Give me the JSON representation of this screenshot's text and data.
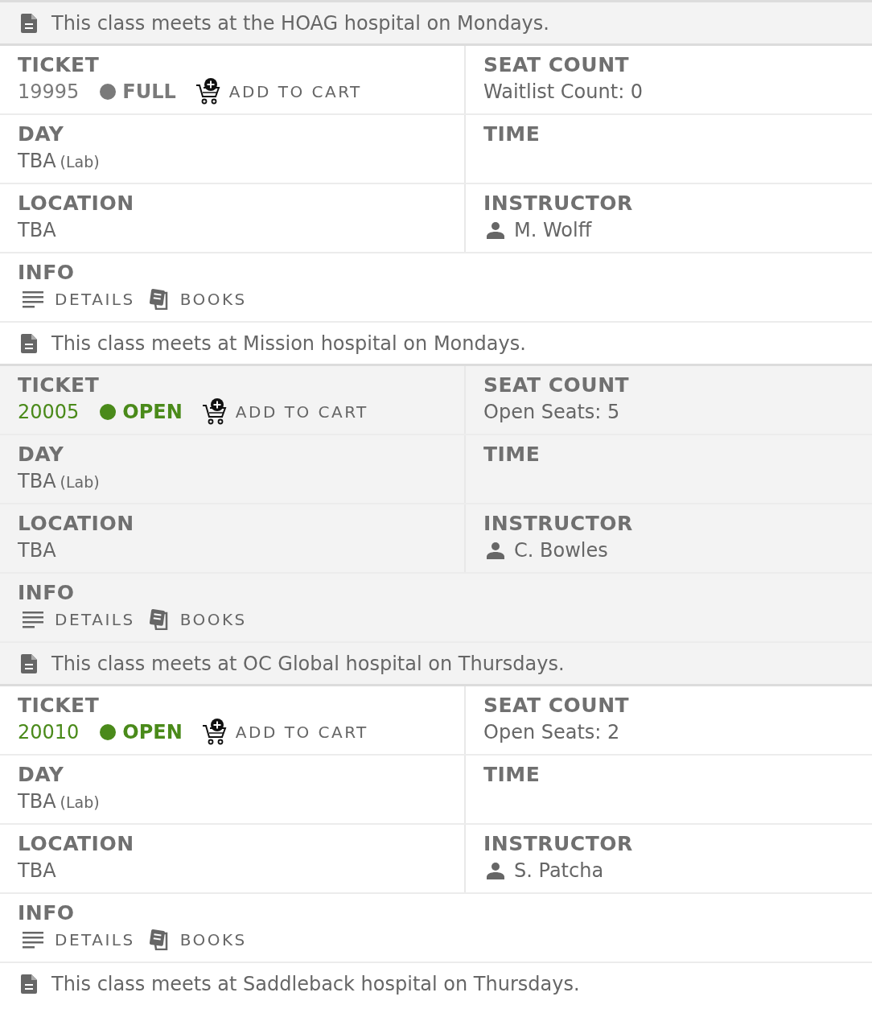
{
  "top_note": {
    "text": "This class meets at the HOAG hospital on Mondays.",
    "shaded": true
  },
  "sections": [
    {
      "shaded": false,
      "ticket": {
        "label": "TICKET",
        "number": "19995",
        "status": "FULL",
        "open": false,
        "cart": "ADD TO CART"
      },
      "seat": {
        "label": "SEAT COUNT",
        "value": "Waitlist Count: 0"
      },
      "day": {
        "label": "DAY",
        "value": "TBA",
        "note": "(Lab)"
      },
      "time": {
        "label": "TIME"
      },
      "location": {
        "label": "LOCATION",
        "value": "TBA"
      },
      "instructor": {
        "label": "INSTRUCTOR",
        "name": "M. Wolff"
      },
      "info": {
        "label": "INFO",
        "links": [
          {
            "kind": "details",
            "text": "DETAILS"
          },
          {
            "kind": "books",
            "text": "BOOKS"
          }
        ]
      },
      "note": "This class meets at Mission hospital on Mondays."
    },
    {
      "shaded": true,
      "ticket": {
        "label": "TICKET",
        "number": "20005",
        "status": "OPEN",
        "open": true,
        "cart": "ADD TO CART"
      },
      "seat": {
        "label": "SEAT COUNT",
        "value": "Open Seats: 5"
      },
      "day": {
        "label": "DAY",
        "value": "TBA",
        "note": "(Lab)"
      },
      "time": {
        "label": "TIME"
      },
      "location": {
        "label": "LOCATION",
        "value": "TBA"
      },
      "instructor": {
        "label": "INSTRUCTOR",
        "name": "C. Bowles"
      },
      "info": {
        "label": "INFO",
        "links": [
          {
            "kind": "details",
            "text": "DETAILS"
          },
          {
            "kind": "books",
            "text": "BOOKS"
          }
        ]
      },
      "note": "This class meets at OC Global hospital on Thursdays."
    },
    {
      "shaded": false,
      "ticket": {
        "label": "TICKET",
        "number": "20010",
        "status": "OPEN",
        "open": true,
        "cart": "ADD TO CART"
      },
      "seat": {
        "label": "SEAT COUNT",
        "value": "Open Seats: 2"
      },
      "day": {
        "label": "DAY",
        "value": "TBA",
        "note": "(Lab)"
      },
      "time": {
        "label": "TIME"
      },
      "location": {
        "label": "LOCATION",
        "value": "TBA"
      },
      "instructor": {
        "label": "INSTRUCTOR",
        "name": "S. Patcha"
      },
      "info": {
        "label": "INFO",
        "links": [
          {
            "kind": "details",
            "text": "DETAILS"
          },
          {
            "kind": "books",
            "text": "BOOKS"
          }
        ]
      },
      "note": "This class meets at Saddleback hospital on Thursdays."
    }
  ]
}
